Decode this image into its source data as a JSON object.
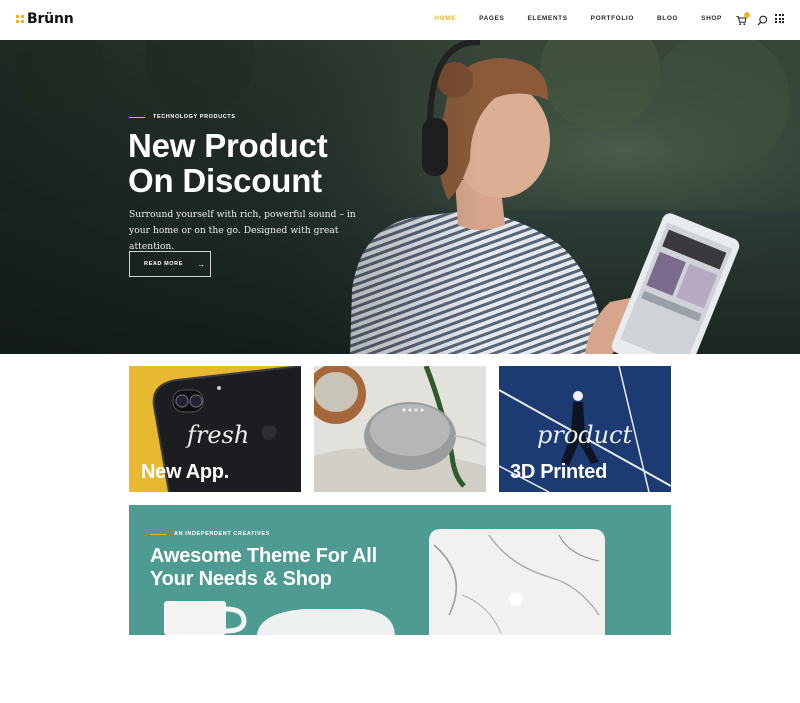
{
  "brand": {
    "name": "Brünn",
    "accent": "#f3b41f"
  },
  "nav": {
    "items": [
      {
        "label": "HOME",
        "active": true
      },
      {
        "label": "PAGES"
      },
      {
        "label": "ELEMENTS"
      },
      {
        "label": "PORTFOLIO"
      },
      {
        "label": "BLOG"
      },
      {
        "label": "SHOP"
      }
    ],
    "icons": [
      "cart-icon",
      "search-icon",
      "grid-menu-icon"
    ]
  },
  "hero": {
    "eyebrow": "TECHNOLOGY PRODUCTS",
    "title_line1": "New Product",
    "title_line2": "On Discount",
    "subtitle": "Surround yourself with rich, powerful sound – in your home or on the go. Designed with great attention.",
    "button_label": "READ MORE",
    "button_arrow": "→"
  },
  "cards": [
    {
      "script": "fresh",
      "title": "New App.",
      "background": "#e6b930"
    },
    {
      "script": "",
      "title": "",
      "background": "#d9d6d0"
    },
    {
      "script": "product",
      "title": "3D Printed",
      "background": "#1d3b73"
    }
  ],
  "banner": {
    "eyebrow": "AN INDEPENDENT CREATIVES",
    "title_line1": "Awesome Theme For All",
    "title_line2": "Your Needs & Shop",
    "background": "#4e9b91"
  }
}
